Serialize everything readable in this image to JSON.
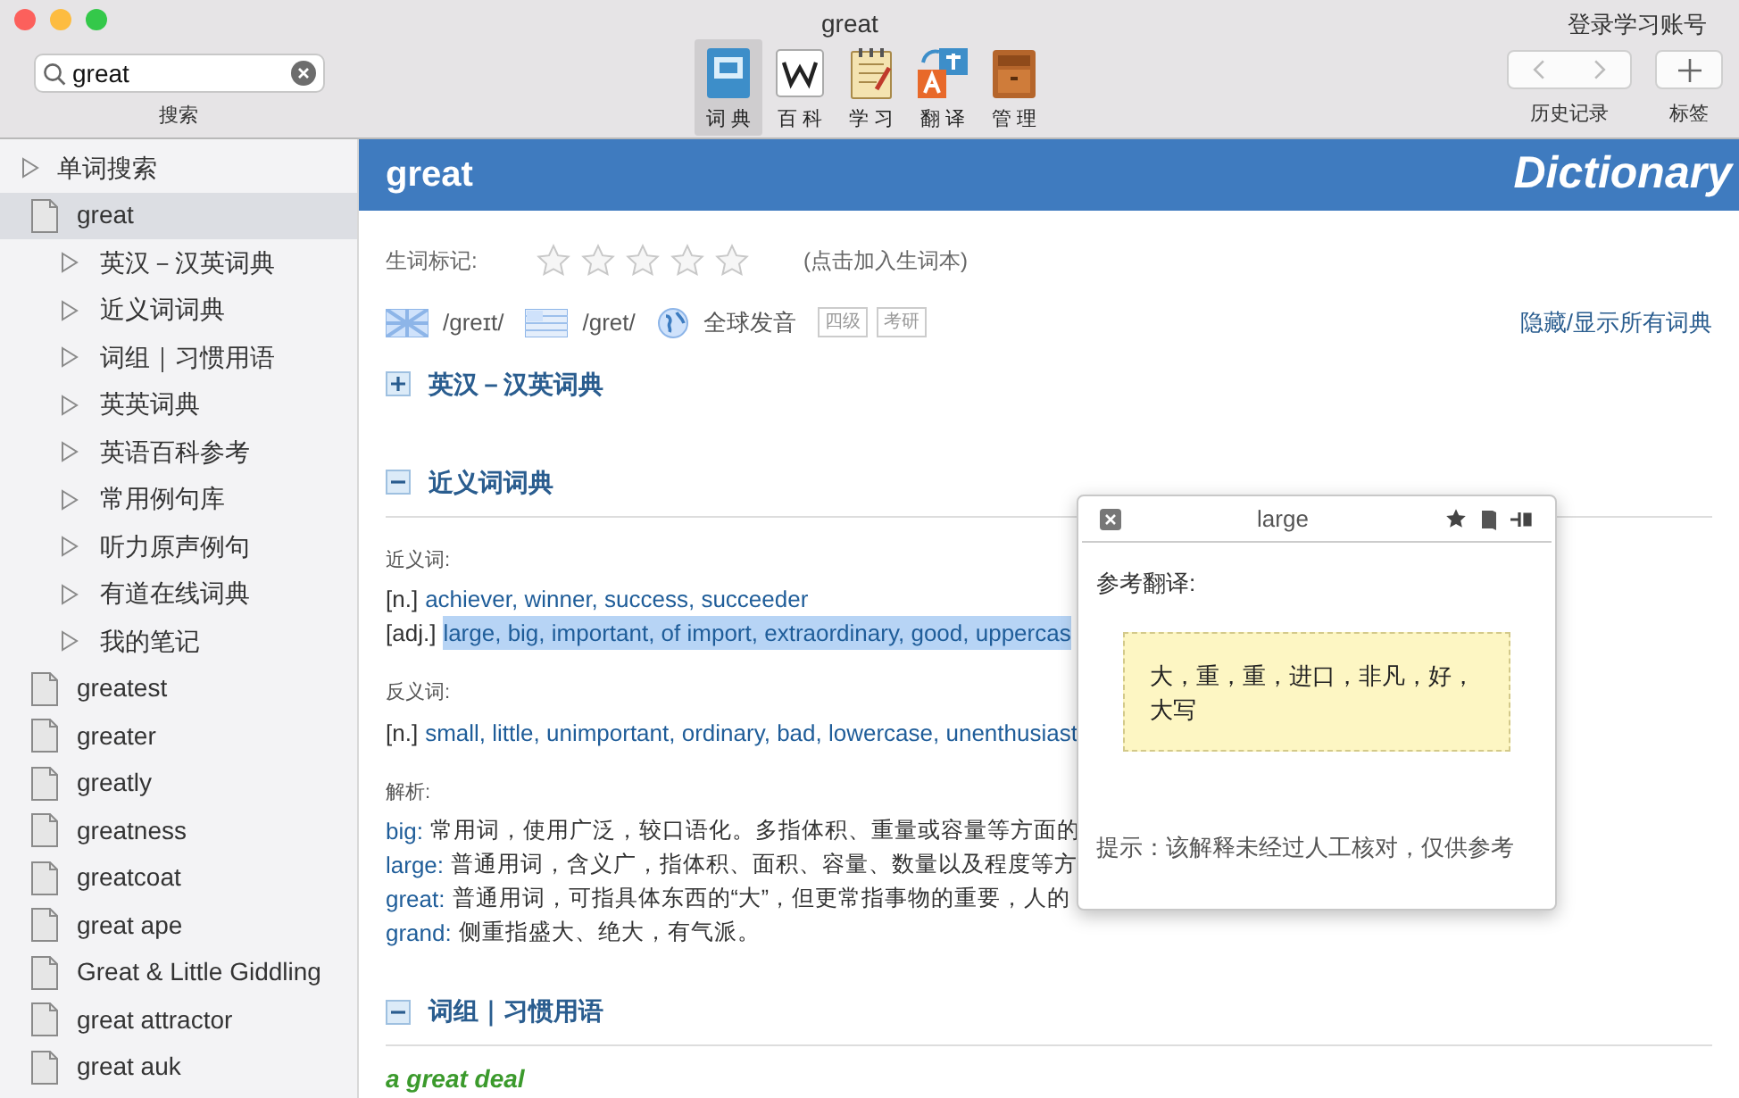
{
  "window": {
    "title": "great",
    "account_link": "登录学习账号"
  },
  "search": {
    "value": "great",
    "label": "搜索"
  },
  "toolbar_tabs": [
    {
      "label": "词 典",
      "selected": true,
      "kind": "dict"
    },
    {
      "label": "百 科",
      "selected": false,
      "kind": "wiki"
    },
    {
      "label": "学 习",
      "selected": false,
      "kind": "study"
    },
    {
      "label": "翻 译",
      "selected": false,
      "kind": "translate"
    },
    {
      "label": "管 理",
      "selected": false,
      "kind": "manage"
    }
  ],
  "history": {
    "label": "历史记录"
  },
  "bookmark": {
    "label": "标签"
  },
  "sidebar": {
    "items": [
      {
        "label": "单词搜索",
        "kind": "group",
        "selected": false,
        "expanded": false
      },
      {
        "label": "great",
        "kind": "word",
        "selected": true,
        "expanded": true,
        "children": [
          {
            "label": "英汉－汉英词典"
          },
          {
            "label": "近义词词典"
          },
          {
            "label": "词组｜习惯用语"
          },
          {
            "label": "英英词典"
          },
          {
            "label": "英语百科参考"
          },
          {
            "label": "常用例句库"
          },
          {
            "label": "听力原声例句"
          },
          {
            "label": "有道在线词典"
          },
          {
            "label": "我的笔记"
          }
        ]
      },
      {
        "label": "greatest",
        "kind": "word",
        "selected": false
      },
      {
        "label": "greater",
        "kind": "word",
        "selected": false
      },
      {
        "label": "greatly",
        "kind": "word",
        "selected": false
      },
      {
        "label": "greatness",
        "kind": "word",
        "selected": false
      },
      {
        "label": "greatcoat",
        "kind": "word",
        "selected": false
      },
      {
        "label": "great ape",
        "kind": "word",
        "selected": false
      },
      {
        "label": "Great & Little Giddling",
        "kind": "word",
        "selected": false
      },
      {
        "label": "great attractor",
        "kind": "word",
        "selected": false
      },
      {
        "label": "great auk",
        "kind": "word",
        "selected": false
      }
    ]
  },
  "header": {
    "word": "great",
    "brand": "Dictionary"
  },
  "word_mark": {
    "label": "生词标记:",
    "stars": 0,
    "hint": "(点击加入生词本)"
  },
  "pronunciations": [
    {
      "kind": "uk",
      "text": "/greɪt/"
    },
    {
      "kind": "us",
      "text": "/gret/"
    },
    {
      "kind": "globe",
      "text": "全球发音"
    }
  ],
  "tags": [
    "四级",
    "考研"
  ],
  "toggle_all_link": "隐藏/显示所有词典",
  "sections": [
    {
      "title": "英汉－汉英词典",
      "expanded": false
    },
    {
      "title": "近义词词典",
      "expanded": true,
      "kind": "thesaurus"
    },
    {
      "title": "词组｜习惯用语",
      "expanded": true,
      "kind": "phrases"
    }
  ],
  "thesaurus": {
    "synonyms_label": "近义词:",
    "synonyms": [
      {
        "pos": "[n.]",
        "words": "achiever, winner, success, succeeder",
        "highlighted": false
      },
      {
        "pos": "[adj.]",
        "words": "large, big, important, of import, extraordinary, good, uppercas",
        "highlighted": true
      }
    ],
    "antonyms_label": "反义词:",
    "antonyms": [
      {
        "pos": "[n.]",
        "words": "small, little, unimportant, ordinary, bad, lowercase, unenthusiast",
        "highlighted": false
      }
    ],
    "analysis_label": "解析:",
    "analysis": [
      {
        "term": "big:",
        "text": "常用词，使用广泛，较口语化。多指体积、重量或容量等方面的"
      },
      {
        "term": "large:",
        "text": "普通用词，含义广，指体积、面积、容量、数量以及程度等方"
      },
      {
        "term": "great:",
        "text": "普通用词，可指具体东西的“大”，但更常指事物的重要，人的"
      },
      {
        "term": "grand:",
        "text": "侧重指盛大、绝大，有气派。"
      }
    ]
  },
  "phrases": [
    {
      "text": "a great deal"
    }
  ],
  "popup": {
    "title": "large",
    "label": "参考翻译:",
    "translation": "大，重，重，进口，非凡，好，大写",
    "hint": "提示：该解释未经过人工核对，仅供参考"
  }
}
